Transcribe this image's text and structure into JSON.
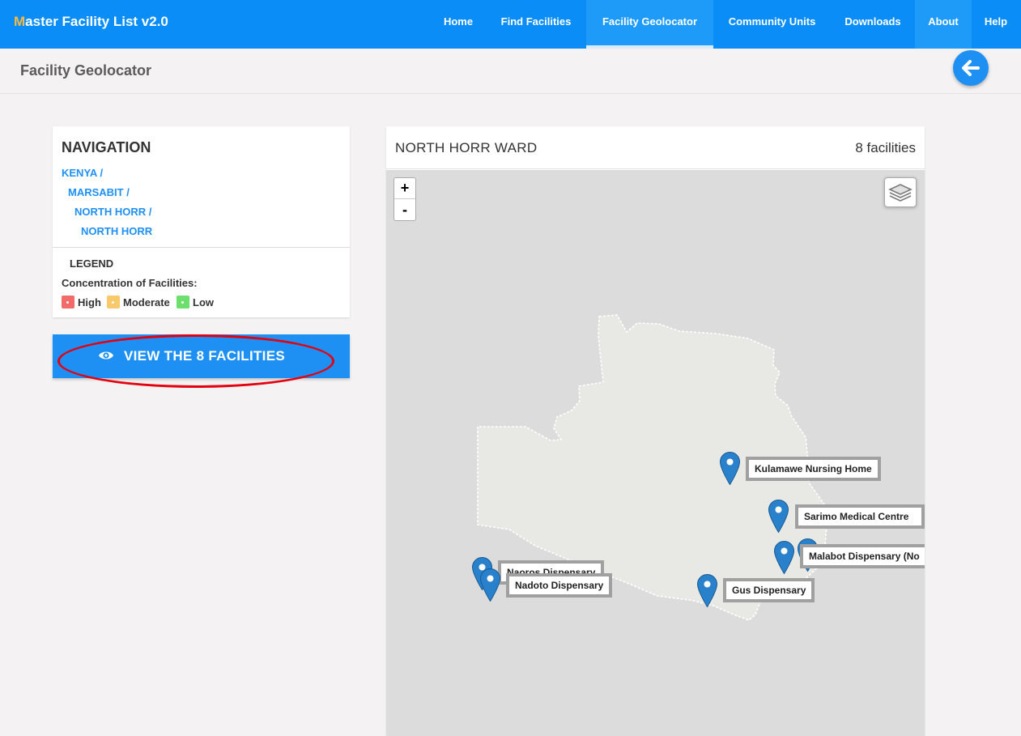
{
  "navbar": {
    "brand_first": "M",
    "brand_rest": "aster Facility List v2.0",
    "items": [
      "Home",
      "Find Facilities",
      "Facility Geolocator",
      "Community Units",
      "Downloads",
      "About",
      "Help"
    ]
  },
  "page": {
    "title": "Facility Geolocator"
  },
  "navigation": {
    "heading": "NAVIGATION",
    "crumbs": [
      "KENYA /",
      "MARSABIT /",
      "NORTH HORR /",
      "NORTH HORR"
    ]
  },
  "legend": {
    "title": "LEGEND",
    "subtitle": "Concentration of Facilities:",
    "items": [
      {
        "label": "High",
        "color": "#f26b6b"
      },
      {
        "label": "Moderate",
        "color": "#f9c86b"
      },
      {
        "label": "Low",
        "color": "#6cdf6c"
      }
    ]
  },
  "view_button": {
    "label": "VIEW THE 8 FACILITIES"
  },
  "map": {
    "ward": "NORTH HORR WARD",
    "count": "8 facilities",
    "zoom_in": "+",
    "zoom_out": "-",
    "facilities": [
      "Kulamawe Nursing Home",
      "Sarimo Medical Centre",
      "Malabot Dispensary (No",
      "Naoros Dispensary",
      "Nadoto Dispensary",
      "Gus Dispensary"
    ]
  },
  "colors": {
    "navbar": "#0a8df7",
    "accent": "#1e90f4",
    "highlight": "#e3000f",
    "brand_initial": "#f5b944"
  }
}
